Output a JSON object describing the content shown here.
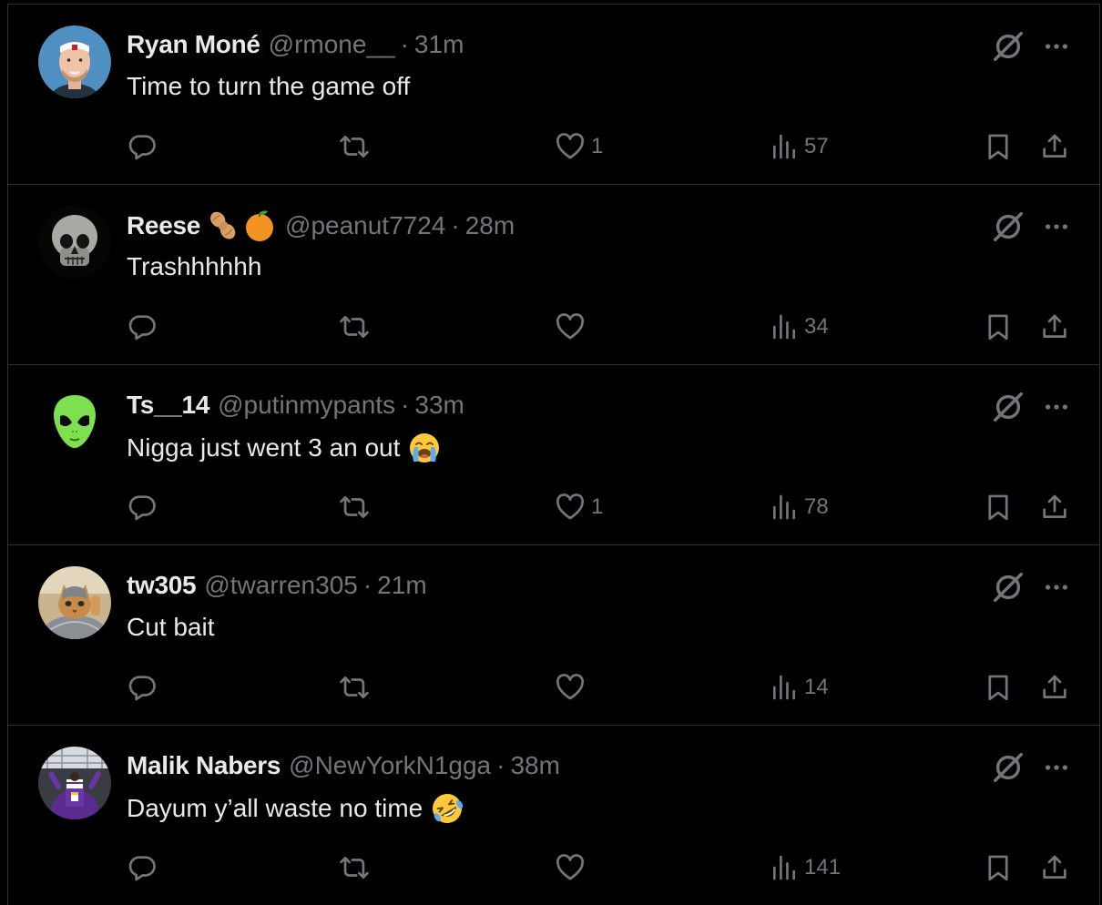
{
  "colors": {
    "background": "#000000",
    "divider": "#2f3336",
    "primary_text": "#e7e9ea",
    "secondary_text": "#71767b"
  },
  "icons": {
    "grok": "slashed-circle-icon",
    "more": "ellipsis-icon",
    "reply": "speech-bubble-icon",
    "retweet": "retweet-arrows-icon",
    "like": "heart-icon",
    "views": "bar-chart-icon",
    "bookmark": "bookmark-icon",
    "share": "share-upload-icon"
  },
  "tweets": [
    {
      "name": "Ryan Moné",
      "handle": "@rmone__",
      "separator": "·",
      "time": "31m",
      "text": "Time to turn the game off",
      "likes": "1",
      "views": "57"
    },
    {
      "name": "Reese",
      "name_emojis": [
        "peanut",
        "orange"
      ],
      "handle": "@peanut7724",
      "separator": "·",
      "time": "28m",
      "text": "Trashhhhhh",
      "likes": "",
      "views": "34"
    },
    {
      "name": "Ts__14",
      "handle": "@putinmypants",
      "separator": "·",
      "time": "33m",
      "text": "Nigga just went 3 an out",
      "text_emoji": "loudly-crying-face",
      "likes": "1",
      "views": "78"
    },
    {
      "name": "tw305",
      "handle": "@twarren305",
      "separator": "·",
      "time": "21m",
      "text": "Cut bait",
      "likes": "",
      "views": "14"
    },
    {
      "name": "Malik Nabers",
      "handle": "@NewYorkN1gga",
      "separator": "·",
      "time": "38m",
      "text": "Dayum y’all waste no time",
      "text_emoji": "rolling-on-floor-laughing",
      "likes": "",
      "views": "141"
    }
  ]
}
